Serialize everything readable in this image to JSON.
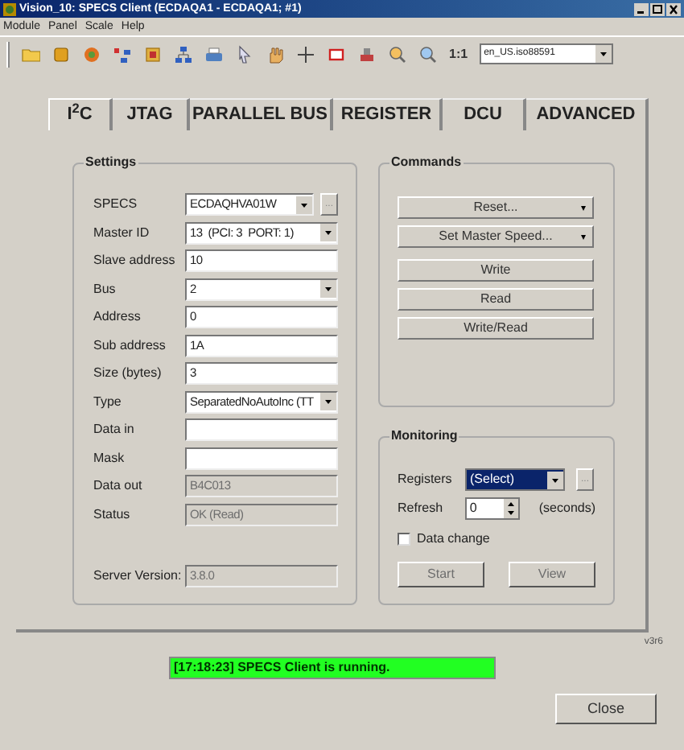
{
  "window": {
    "title": "Vision_10: SPECS Client (ECDAQA1 - ECDAQA1; #1)"
  },
  "menu": [
    "Module",
    "Panel",
    "Scale",
    "Help"
  ],
  "toolbar": {
    "zoom_label": "1:1",
    "locale": "en_US.iso88591"
  },
  "tabs": [
    {
      "label": "I$^{2}$C",
      "selected": true
    },
    {
      "label": "JTAG",
      "selected": false
    },
    {
      "label": "PARALLEL BUS",
      "selected": false
    },
    {
      "label": "REGISTER",
      "selected": false
    },
    {
      "label": "DCU",
      "selected": false
    },
    {
      "label": "ADVANCED",
      "selected": false
    }
  ],
  "settings": {
    "title": "Settings",
    "fields": [
      {
        "label": "SPECS",
        "kind": "select",
        "value": "ECDAQHVA01W",
        "browse": "..."
      },
      {
        "label": "Master ID",
        "kind": "select",
        "value": "13  (PCI: 3  PORT: 1)"
      },
      {
        "label": "Slave address",
        "kind": "text",
        "value": "10"
      },
      {
        "label": "Bus",
        "kind": "select",
        "value": "2"
      },
      {
        "label": "Address",
        "kind": "text",
        "value": "0"
      },
      {
        "label": "Sub address",
        "kind": "text",
        "value": "1A"
      },
      {
        "label": "Size (bytes)",
        "kind": "text",
        "value": "3"
      },
      {
        "label": "Type",
        "kind": "select",
        "value": "SeparatedNoAutoInc (TT"
      },
      {
        "label": "Data in",
        "kind": "text"
      },
      {
        "label": "Mask",
        "kind": "text"
      },
      {
        "label": "Data out",
        "kind": "readonly",
        "value": "B4C013"
      },
      {
        "label": "Status",
        "kind": "readonly",
        "value": "OK (Read)"
      }
    ],
    "server_version": {
      "label": "Server Version:",
      "value": "3.8.0"
    }
  },
  "commands": {
    "title": "Commands",
    "buttons": [
      {
        "label": "Reset...",
        "menu": true
      },
      {
        "label": "Set Master Speed...",
        "menu": true
      },
      {
        "label": "Write",
        "menu": false
      },
      {
        "label": "Read",
        "menu": false
      },
      {
        "label": "Write/Read",
        "menu": false
      }
    ]
  },
  "monitoring": {
    "title": "Monitoring",
    "registers": {
      "label": "Registers",
      "value": "(Select)",
      "selected": true,
      "browse": "..."
    },
    "refresh": {
      "label": "Refresh",
      "value": "0",
      "unit": "(seconds)"
    },
    "data_change": {
      "label": "Data change",
      "checked": false
    },
    "buttons": [
      {
        "label": "Start",
        "disabled": true
      },
      {
        "label": "View",
        "disabled": true
      }
    ]
  },
  "version": "v3r6",
  "status_message": "[17:18:23] SPECS Client is running.",
  "close": "Close"
}
